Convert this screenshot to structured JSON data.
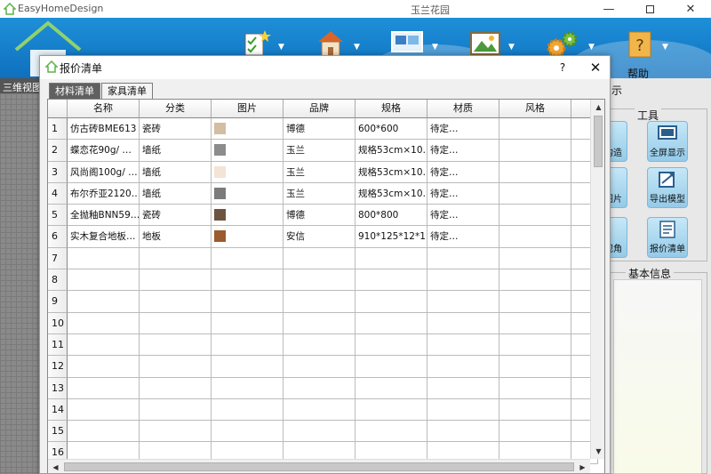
{
  "app": {
    "name": "EasyHomeDesign",
    "doc_title": "玉兰花园"
  },
  "ribbon": {
    "help_label": "帮助"
  },
  "left_panel": {
    "view_tab": "三维视图"
  },
  "right_panel": {
    "show_label": "示",
    "tools_title": "工具",
    "tools": [
      {
        "label": "构造",
        "icon": "structure-icon"
      },
      {
        "label": "全屏显示",
        "icon": "fullscreen-icon"
      },
      {
        "label": "图片",
        "icon": "picture-icon"
      },
      {
        "label": "导出模型",
        "icon": "export-model-icon"
      },
      {
        "label": "视角",
        "icon": "view-angle-icon"
      },
      {
        "label": "报价清单",
        "icon": "quote-list-icon"
      }
    ],
    "basic_info_title": "基本信息"
  },
  "dialog": {
    "title": "报价清单",
    "help": "?",
    "close": "✕",
    "tabs": [
      {
        "label": "材料清单",
        "active": true
      },
      {
        "label": "家具清单",
        "active": false
      }
    ],
    "columns": [
      "名称",
      "分类",
      "图片",
      "品牌",
      "规格",
      "材质",
      "风格"
    ],
    "rows": [
      {
        "num": "1",
        "name": "仿古砖BME613",
        "category": "瓷砖",
        "swatch": "#d3bda3",
        "brand": "博德",
        "spec": "600*600",
        "material": "待定…",
        "style": ""
      },
      {
        "num": "2",
        "name": "蝶恋花90g/ …",
        "category": "墙纸",
        "swatch": "#8c8c8c",
        "brand": "玉兰",
        "spec": "规格53cm×10…",
        "material": "待定…",
        "style": ""
      },
      {
        "num": "3",
        "name": "风尚阁100g/ …",
        "category": "墙纸",
        "swatch": "#f3e4d6",
        "brand": "玉兰",
        "spec": "规格53cm×10…",
        "material": "待定…",
        "style": ""
      },
      {
        "num": "4",
        "name": "布尔乔亚2120…",
        "category": "墙纸",
        "swatch": "#7b7b7b",
        "brand": "玉兰",
        "spec": "规格53cm×10…",
        "material": "待定…",
        "style": ""
      },
      {
        "num": "5",
        "name": "全抛釉BNN59…",
        "category": "瓷砖",
        "swatch": "#6e5440",
        "brand": "博德",
        "spec": "800*800",
        "material": "待定…",
        "style": ""
      },
      {
        "num": "6",
        "name": "实木复合地板…",
        "category": "地板",
        "swatch": "#9a5b2e",
        "brand": "安信",
        "spec": "910*125*12*1…",
        "material": "待定…",
        "style": ""
      },
      {
        "num": "7",
        "name": "",
        "category": "",
        "swatch": "",
        "brand": "",
        "spec": "",
        "material": "",
        "style": ""
      },
      {
        "num": "8",
        "name": "",
        "category": "",
        "swatch": "",
        "brand": "",
        "spec": "",
        "material": "",
        "style": ""
      },
      {
        "num": "9",
        "name": "",
        "category": "",
        "swatch": "",
        "brand": "",
        "spec": "",
        "material": "",
        "style": ""
      },
      {
        "num": "10",
        "name": "",
        "category": "",
        "swatch": "",
        "brand": "",
        "spec": "",
        "material": "",
        "style": ""
      },
      {
        "num": "11",
        "name": "",
        "category": "",
        "swatch": "",
        "brand": "",
        "spec": "",
        "material": "",
        "style": ""
      },
      {
        "num": "12",
        "name": "",
        "category": "",
        "swatch": "",
        "brand": "",
        "spec": "",
        "material": "",
        "style": ""
      },
      {
        "num": "13",
        "name": "",
        "category": "",
        "swatch": "",
        "brand": "",
        "spec": "",
        "material": "",
        "style": ""
      },
      {
        "num": "14",
        "name": "",
        "category": "",
        "swatch": "",
        "brand": "",
        "spec": "",
        "material": "",
        "style": ""
      },
      {
        "num": "15",
        "name": "",
        "category": "",
        "swatch": "",
        "brand": "",
        "spec": "",
        "material": "",
        "style": ""
      },
      {
        "num": "16",
        "name": "",
        "category": "",
        "swatch": "",
        "brand": "",
        "spec": "",
        "material": "",
        "style": ""
      }
    ]
  }
}
